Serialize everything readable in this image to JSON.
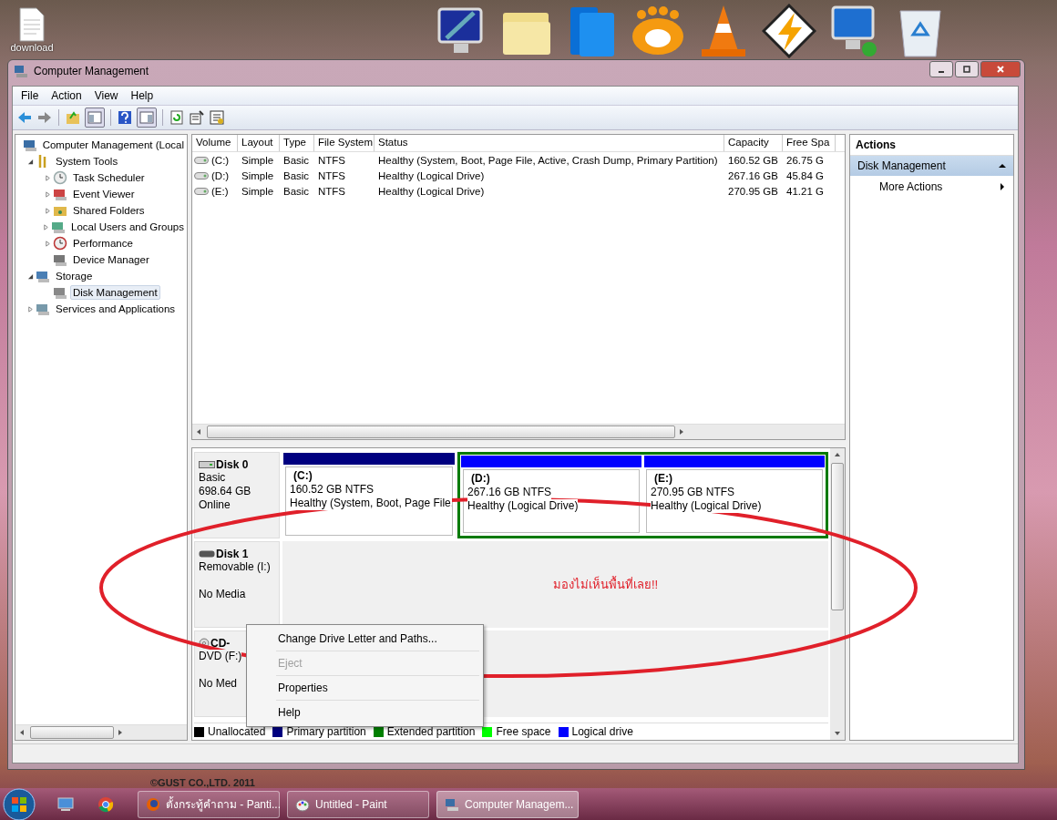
{
  "desktop": {
    "file_icon_label": "download",
    "wallpaper_text": "©GUST CO.,LTD. 2011"
  },
  "window": {
    "title": "Computer Management"
  },
  "menu": [
    "File",
    "Action",
    "View",
    "Help"
  ],
  "tree": [
    {
      "label": "Computer Management (Local",
      "selected": false,
      "children": [
        {
          "label": "System Tools",
          "expanded": true,
          "selected": false,
          "children": [
            {
              "label": "Task Scheduler",
              "expanded": false,
              "selected": false
            },
            {
              "label": "Event Viewer",
              "expanded": false,
              "selected": false
            },
            {
              "label": "Shared Folders",
              "expanded": false,
              "selected": false
            },
            {
              "label": "Local Users and Groups",
              "expanded": false,
              "selected": false
            },
            {
              "label": "Performance",
              "expanded": false,
              "selected": false
            },
            {
              "label": "Device Manager",
              "selected": false
            }
          ]
        },
        {
          "label": "Storage",
          "expanded": true,
          "selected": false,
          "children": [
            {
              "label": "Disk Management",
              "selected": true
            }
          ]
        },
        {
          "label": "Services and Applications",
          "expanded": false,
          "selected": false
        }
      ]
    }
  ],
  "table": {
    "columns": [
      "Volume",
      "Layout",
      "Type",
      "File System",
      "Status",
      "Capacity",
      "Free Spa"
    ],
    "rows": [
      {
        "cells": [
          "(C:)",
          "Simple",
          "Basic",
          "NTFS",
          "Healthy (System, Boot, Page File, Active, Crash Dump, Primary Partition)",
          "160.52 GB",
          "26.75 G"
        ]
      },
      {
        "cells": [
          "(D:)",
          "Simple",
          "Basic",
          "NTFS",
          "Healthy (Logical Drive)",
          "267.16 GB",
          "45.84 G"
        ]
      },
      {
        "cells": [
          "(E:)",
          "Simple",
          "Basic",
          "NTFS",
          "Healthy (Logical Drive)",
          "270.95 GB",
          "41.21 G"
        ]
      }
    ]
  },
  "disks": [
    {
      "name": "Disk 0",
      "kind": "hdd",
      "lines": [
        "Basic",
        "698.64 GB",
        "Online"
      ],
      "partitions": [
        {
          "kind": "primary",
          "label": "(C:)",
          "size": "160.52 GB NTFS",
          "status": "Healthy (System, Boot, Page File,"
        },
        {
          "kind": "extended",
          "children": [
            {
              "kind": "logical",
              "label": "(D:)",
              "size": "267.16 GB NTFS",
              "status": "Healthy (Logical Drive)"
            },
            {
              "kind": "logical",
              "label": "(E:)",
              "size": "270.95 GB NTFS",
              "status": "Healthy (Logical Drive)"
            }
          ]
        }
      ]
    },
    {
      "name": "Disk 1",
      "kind": "removable",
      "lines": [
        "Removable (I:)",
        "No Media"
      ],
      "note": "มองไม่เห็นพื้นที่เลย!!"
    },
    {
      "name": "CD-",
      "kind": "cdrom",
      "lines": [
        "DVD (F:)",
        "No Med"
      ]
    }
  ],
  "legend": [
    {
      "label": "Unallocated",
      "color": "#000000"
    },
    {
      "label": "Primary partition",
      "color": "#000080"
    },
    {
      "label": "Extended partition",
      "color": "#008000"
    },
    {
      "label": "Free space",
      "color": "#00ff00"
    },
    {
      "label": "Logical drive",
      "color": "#0000ff"
    }
  ],
  "context_menu": [
    {
      "label": "Change Drive Letter and Paths...",
      "disabled": false
    },
    {
      "label": "Eject",
      "disabled": true
    },
    {
      "label": "Properties",
      "disabled": false
    },
    {
      "label": "Help",
      "disabled": false
    }
  ],
  "actions": {
    "title": "Actions",
    "section": "Disk Management",
    "expanded": true,
    "items": [
      "More Actions"
    ]
  },
  "taskbar": [
    {
      "label": "ตั้งกระทู้คำถาม - Panti...",
      "selected": false
    },
    {
      "label": "Untitled - Paint",
      "selected": false
    },
    {
      "label": "Computer Managem...",
      "selected": true
    }
  ]
}
